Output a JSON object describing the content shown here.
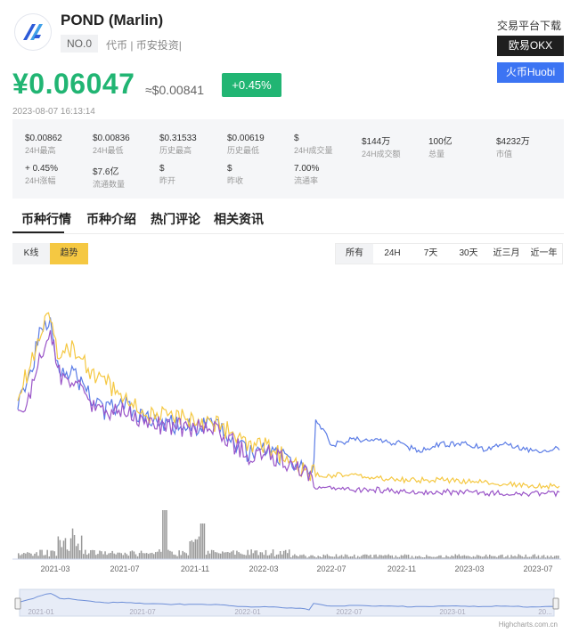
{
  "header": {
    "coin_name": "POND (Marlin)",
    "rank": "NO.0",
    "tags": "代币 | 币安投资|",
    "logo_icon": "marlin-logo-icon"
  },
  "exchanges": {
    "title": "交易平台下载",
    "okx_label": "欧易OKX",
    "huobi_label": "火币Huobi",
    "okx_color": "#1f1f1f",
    "huobi_color": "#3c74f3"
  },
  "price": {
    "cny": "¥0.06047",
    "usd": "≈$0.00841",
    "change": "+0.45%",
    "timestamp": "2023-08-07 16:13:14",
    "up_color": "#21b573"
  },
  "stats": [
    {
      "value": "$0.00862",
      "label": "24H最高"
    },
    {
      "value": "$0.00836",
      "label": "24H最低"
    },
    {
      "value": "$0.31533",
      "label": "历史最高"
    },
    {
      "value": "$0.00619",
      "label": "历史最低"
    },
    {
      "value": "$",
      "label": "24H成交量"
    },
    {
      "value": "$144万",
      "label": "24H成交额"
    },
    {
      "value": "100亿",
      "label": "总量"
    },
    {
      "value": "$4232万",
      "label": "市值"
    },
    {
      "value": "+ 0.45%",
      "label": "24H涨幅"
    },
    {
      "value": "$7.6亿",
      "label": "流通数量"
    },
    {
      "value": "$",
      "label": "昨开"
    },
    {
      "value": "$",
      "label": "昨收"
    },
    {
      "value": "7.00%",
      "label": "流通率"
    }
  ],
  "tabs": [
    "币种行情",
    "币种介绍",
    "热门评论",
    "相关资讯"
  ],
  "modes": {
    "kline": "K线",
    "trend": "趋势"
  },
  "ranges": [
    "所有",
    "24H",
    "7天",
    "30天",
    "近三月",
    "近一年"
  ],
  "chart_data": {
    "type": "line",
    "x_tick_labels": [
      "2021-03",
      "2021-07",
      "2021-11",
      "2022-03",
      "2022-07",
      "2022-11",
      "2023-03",
      "2023-07"
    ],
    "navigator_labels": [
      "2021-01",
      "2021-07",
      "2022-01",
      "2022-07",
      "2023-01",
      "20..."
    ],
    "series": [
      {
        "color": "#5b7ce6",
        "points": [
          [
            0,
            0.55
          ],
          [
            0.02,
            0.66
          ],
          [
            0.04,
            0.87
          ],
          [
            0.06,
            0.98
          ],
          [
            0.075,
            0.71
          ],
          [
            0.1,
            0.69
          ],
          [
            0.13,
            0.58
          ],
          [
            0.16,
            0.49
          ],
          [
            0.19,
            0.53
          ],
          [
            0.24,
            0.44
          ],
          [
            0.3,
            0.42
          ],
          [
            0.37,
            0.41
          ],
          [
            0.4,
            0.33
          ],
          [
            0.43,
            0.27
          ],
          [
            0.46,
            0.3
          ],
          [
            0.5,
            0.24
          ],
          [
            0.53,
            0.2
          ],
          [
            0.545,
            0.13
          ],
          [
            0.55,
            0.45
          ],
          [
            0.58,
            0.32
          ],
          [
            0.62,
            0.35
          ],
          [
            0.66,
            0.34
          ],
          [
            0.7,
            0.33
          ],
          [
            0.74,
            0.29
          ],
          [
            0.78,
            0.32
          ],
          [
            0.82,
            0.33
          ],
          [
            0.86,
            0.3
          ],
          [
            0.9,
            0.33
          ],
          [
            0.95,
            0.29
          ],
          [
            1,
            0.3
          ]
        ]
      },
      {
        "color": "#f5c842",
        "points": [
          [
            0,
            0.58
          ],
          [
            0.02,
            0.7
          ],
          [
            0.04,
            0.9
          ],
          [
            0.06,
            1.0
          ],
          [
            0.075,
            0.73
          ],
          [
            0.1,
            0.83
          ],
          [
            0.13,
            0.7
          ],
          [
            0.16,
            0.65
          ],
          [
            0.19,
            0.57
          ],
          [
            0.24,
            0.47
          ],
          [
            0.3,
            0.46
          ],
          [
            0.37,
            0.43
          ],
          [
            0.4,
            0.36
          ],
          [
            0.43,
            0.3
          ],
          [
            0.46,
            0.31
          ],
          [
            0.5,
            0.24
          ],
          [
            0.53,
            0.18
          ],
          [
            0.56,
            0.16
          ],
          [
            0.6,
            0.17
          ],
          [
            0.66,
            0.15
          ],
          [
            0.72,
            0.14
          ],
          [
            0.78,
            0.14
          ],
          [
            0.84,
            0.13
          ],
          [
            0.9,
            0.12
          ],
          [
            0.95,
            0.11
          ],
          [
            1,
            0.11
          ]
        ]
      },
      {
        "color": "#9a55c8",
        "points": [
          [
            0,
            0.45
          ],
          [
            0.02,
            0.55
          ],
          [
            0.04,
            0.75
          ],
          [
            0.06,
            0.9
          ],
          [
            0.075,
            0.68
          ],
          [
            0.1,
            0.65
          ],
          [
            0.13,
            0.54
          ],
          [
            0.16,
            0.47
          ],
          [
            0.19,
            0.5
          ],
          [
            0.24,
            0.42
          ],
          [
            0.3,
            0.41
          ],
          [
            0.37,
            0.4
          ],
          [
            0.4,
            0.32
          ],
          [
            0.43,
            0.25
          ],
          [
            0.46,
            0.28
          ],
          [
            0.5,
            0.22
          ],
          [
            0.53,
            0.17
          ],
          [
            0.55,
            0.1
          ],
          [
            0.6,
            0.09
          ],
          [
            0.66,
            0.09
          ],
          [
            0.72,
            0.08
          ],
          [
            0.78,
            0.08
          ],
          [
            0.84,
            0.075
          ],
          [
            0.9,
            0.07
          ],
          [
            0.95,
            0.07
          ],
          [
            1,
            0.07
          ]
        ]
      }
    ]
  }
}
